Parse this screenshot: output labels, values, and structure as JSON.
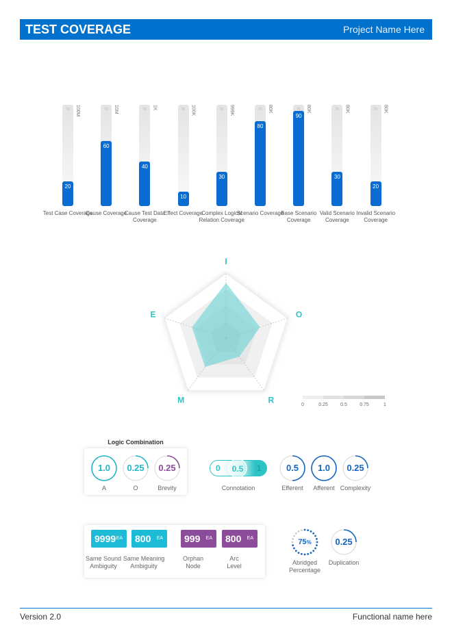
{
  "header": {
    "title": "TEST COVERAGE",
    "project": "Project Name Here"
  },
  "chart_data": [
    {
      "type": "bar",
      "unit_label": "%",
      "categories": [
        "Test Case Coverage",
        "Cause Coverage",
        "Cause Test Data Coverage",
        "Effect Coverage",
        "Complex Logical Relation Coverage",
        "Scenario Coverage",
        "Base Scenario Coverage",
        "Valid Scenario Coverage",
        "Invalid Scenario Coverage"
      ],
      "values": [
        20,
        60,
        40,
        10,
        30,
        80,
        90,
        30,
        20
      ],
      "max_labels": [
        "100M",
        "10M",
        "1K",
        "100K",
        "999K",
        "80K",
        "80K",
        "80K",
        "80K"
      ],
      "ylim": [
        0,
        100
      ],
      "color": "#0A6CD0"
    },
    {
      "type": "radar",
      "axes": [
        "I",
        "O",
        "R",
        "M",
        "E"
      ],
      "values": [
        0.85,
        0.55,
        0.35,
        0.55,
        0.55
      ],
      "range": [
        0,
        1
      ],
      "legend_ticks": [
        "0",
        "0.25",
        "0.5",
        "0.75",
        "1"
      ],
      "color": "#5CCFCF"
    }
  ],
  "logic": {
    "title": "Logic Combination",
    "gauges": [
      {
        "value": "1.0",
        "label": "A",
        "fraction": 1.0,
        "color": "#1FB5C8"
      },
      {
        "value": "0.25",
        "label": "O",
        "fraction": 0.25,
        "color": "#1FB5C8"
      },
      {
        "value": "0.25",
        "label": "Brevity",
        "fraction": 0.25,
        "color": "#8B4C9A"
      }
    ]
  },
  "connotation": {
    "label": "Connotation",
    "options": [
      "0",
      "0.5",
      "1"
    ],
    "selected": "0.5",
    "color": "#2CC4C4"
  },
  "metrics": [
    {
      "value": "0.5",
      "label": "Efferent",
      "fraction": 0.5,
      "color": "#1565C0"
    },
    {
      "value": "1.0",
      "label": "Afferent",
      "fraction": 1.0,
      "color": "#1565C0"
    },
    {
      "value": "0.25",
      "label": "Complexity",
      "fraction": 0.25,
      "color": "#1565C0"
    }
  ],
  "counts": [
    {
      "value": "9999",
      "unit": "EA",
      "label1": "Same Sound",
      "label2": "Ambiguity",
      "color": "#1EBBD7"
    },
    {
      "value": "800",
      "unit": "EA",
      "label1": "Same Meaning",
      "label2": "Ambiguity",
      "color": "#1EBBD7"
    },
    {
      "value": "999",
      "unit": "EA",
      "label1": "Orphan",
      "label2": "Node",
      "color": "#8B4C9A"
    },
    {
      "value": "800",
      "unit": "EA",
      "label1": "Arc",
      "label2": "Level",
      "color": "#8B4C9A"
    }
  ],
  "abridged": {
    "value": "75",
    "unit": "%",
    "label1": "Abridged",
    "label2": "Percentage",
    "fraction": 0.75,
    "color": "#1565C0"
  },
  "duplication": {
    "value": "0.25",
    "label": "Duplication",
    "fraction": 0.25,
    "color": "#1565C0"
  },
  "footer": {
    "version": "Version 2.0",
    "functional": "Functional name here"
  }
}
